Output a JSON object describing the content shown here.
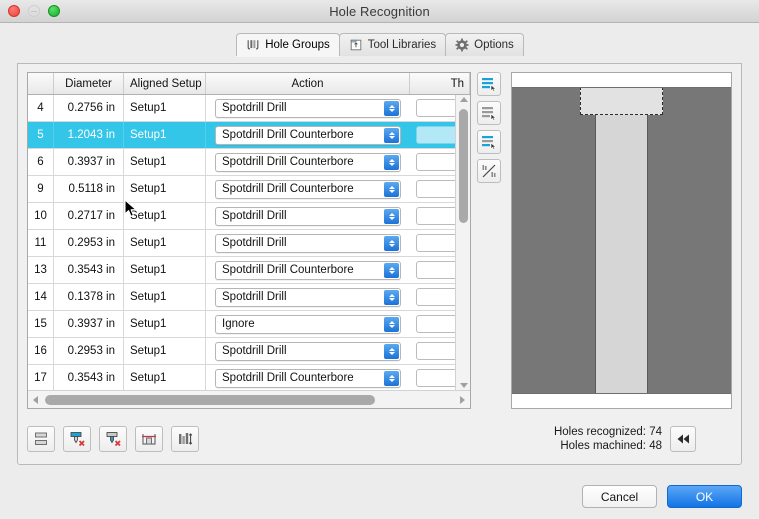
{
  "window": {
    "title": "Hole Recognition",
    "traffic": {
      "close": "close-button",
      "minimize": "minimize-button",
      "zoom": "zoom-button"
    }
  },
  "tabs": [
    {
      "label": "Hole Groups",
      "icon": "hole-groups-icon",
      "active": true
    },
    {
      "label": "Tool Libraries",
      "icon": "tool-libraries-icon",
      "active": false
    },
    {
      "label": "Options",
      "icon": "gear-icon",
      "active": false
    }
  ],
  "table": {
    "columns": [
      "",
      "Diameter",
      "Aligned Setup",
      "Action",
      "Th"
    ],
    "rows": [
      {
        "id": "4",
        "diameter": "0.2756 in",
        "setup": "Setup1",
        "action": "Spotdrill Drill",
        "thread": "",
        "selected": false
      },
      {
        "id": "5",
        "diameter": "1.2043 in",
        "setup": "Setup1",
        "action": "Spotdrill Drill Counterbore",
        "thread": "",
        "selected": true
      },
      {
        "id": "6",
        "diameter": "0.3937 in",
        "setup": "Setup1",
        "action": "Spotdrill Drill Counterbore",
        "thread": "",
        "selected": false
      },
      {
        "id": "9",
        "diameter": "0.5118 in",
        "setup": "Setup1",
        "action": "Spotdrill Drill Counterbore",
        "thread": "",
        "selected": false
      },
      {
        "id": "10",
        "diameter": "0.2717 in",
        "setup": "Setup1",
        "action": "Spotdrill Drill",
        "thread": "",
        "selected": false
      },
      {
        "id": "11",
        "diameter": "0.2953 in",
        "setup": "Setup1",
        "action": "Spotdrill Drill",
        "thread": "",
        "selected": false
      },
      {
        "id": "13",
        "diameter": "0.3543 in",
        "setup": "Setup1",
        "action": "Spotdrill Drill Counterbore",
        "thread": "",
        "selected": false
      },
      {
        "id": "14",
        "diameter": "0.1378 in",
        "setup": "Setup1",
        "action": "Spotdrill Drill",
        "thread": "",
        "selected": false
      },
      {
        "id": "15",
        "diameter": "0.3937 in",
        "setup": "Setup1",
        "action": "Ignore",
        "thread": "",
        "selected": false
      },
      {
        "id": "16",
        "diameter": "0.2953 in",
        "setup": "Setup1",
        "action": "Spotdrill Drill",
        "thread": "",
        "selected": false
      },
      {
        "id": "17",
        "diameter": "0.3543 in",
        "setup": "Setup1",
        "action": "Spotdrill Drill Counterbore",
        "thread": "",
        "selected": false
      }
    ]
  },
  "side_toolbar": [
    {
      "name": "select-all-holes-button"
    },
    {
      "name": "deselect-holes-button"
    },
    {
      "name": "select-similar-holes-button"
    },
    {
      "name": "toggle-hole-chart-button"
    }
  ],
  "bottom_toolbar": [
    {
      "name": "merge-hole-group-button"
    },
    {
      "name": "delete-top-operation-button"
    },
    {
      "name": "delete-bottom-operation-button"
    },
    {
      "name": "edit-hole-depth-button"
    },
    {
      "name": "adjust-hole-sizes-button"
    }
  ],
  "status": {
    "recognized": "Holes recognized: 74",
    "machined": "Holes machined: 48",
    "rewind": "rewind-button"
  },
  "footer": {
    "cancel_label": "Cancel",
    "ok_label": "OK"
  },
  "colors": {
    "selection": "#34c6e8",
    "accent": "#1273e6",
    "stock": "#777777",
    "bore": "#d6d6d6"
  }
}
